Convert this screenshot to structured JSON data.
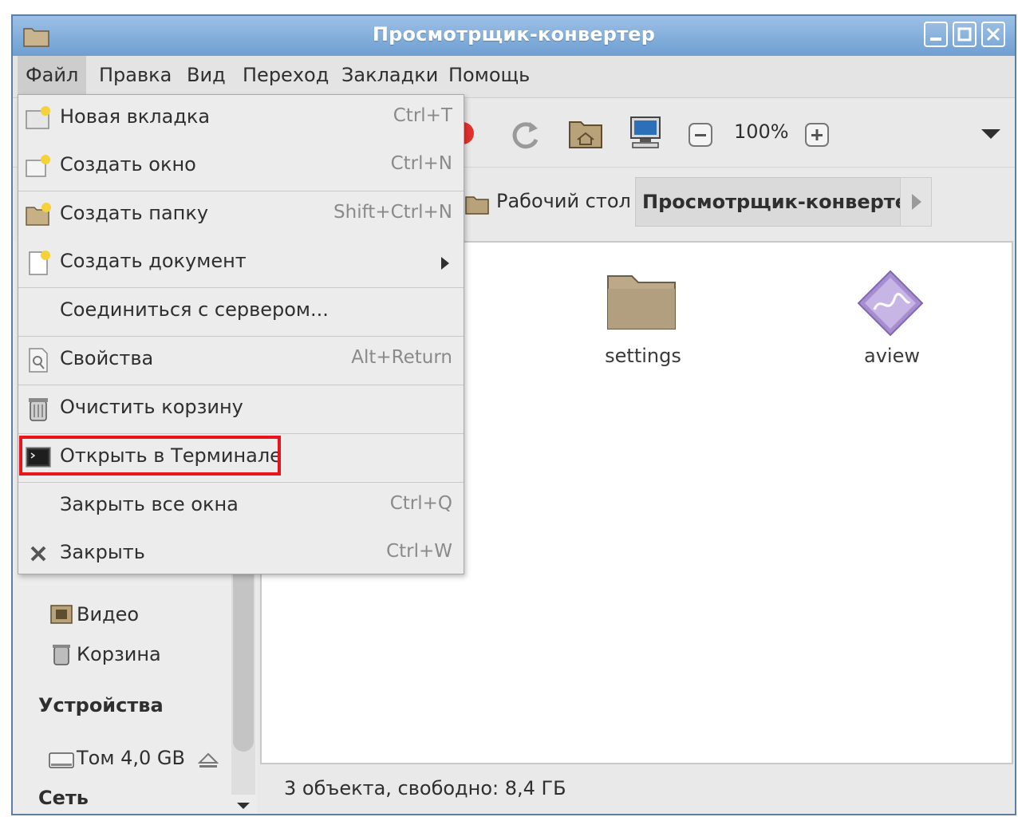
{
  "window": {
    "title": "Просмотрщик-конвертер"
  },
  "menubar": {
    "items": [
      {
        "label": "Файл"
      },
      {
        "label": "Правка"
      },
      {
        "label": "Вид"
      },
      {
        "label": "Переход"
      },
      {
        "label": "Закладки"
      },
      {
        "label": "Помощь"
      }
    ]
  },
  "toolbar": {
    "zoom": "100%"
  },
  "location": {
    "crumbs": [
      {
        "label": "Рабочий стол"
      },
      {
        "label": "Просмотрщик-конвертер"
      }
    ]
  },
  "file_menu": {
    "items": [
      {
        "label": "Новая вкладка",
        "shortcut": "Ctrl+T",
        "icon": "new-tab-icon"
      },
      {
        "label": "Создать окно",
        "shortcut": "Ctrl+N",
        "icon": "new-window-icon"
      },
      {
        "label": "Создать папку",
        "shortcut": "Shift+Ctrl+N",
        "icon": "new-folder-icon"
      },
      {
        "label": "Создать документ",
        "shortcut": "",
        "icon": "new-document-icon"
      },
      {
        "label": "Соединиться с сервером...",
        "shortcut": "",
        "icon": ""
      },
      {
        "label": "Свойства",
        "shortcut": "Alt+Return",
        "icon": "properties-icon"
      },
      {
        "label": "Очистить корзину",
        "shortcut": "",
        "icon": "trash-icon"
      },
      {
        "label": "Открыть в Терминале",
        "shortcut": "",
        "icon": "terminal-icon"
      },
      {
        "label": "Закрыть все окна",
        "shortcut": "Ctrl+Q",
        "icon": ""
      },
      {
        "label": "Закрыть",
        "shortcut": "Ctrl+W",
        "icon": "close-icon"
      }
    ]
  },
  "sidebar": {
    "places": [
      {
        "label": "Видео",
        "icon": "video-folder-icon"
      },
      {
        "label": "Корзина",
        "icon": "trash-icon"
      }
    ],
    "devices_heading": "Устройства",
    "devices": [
      {
        "label": "Том 4,0 GB",
        "icon": "drive-icon"
      }
    ],
    "network_heading": "Сеть"
  },
  "files": [
    {
      "name": "settings",
      "icon": "folder-icon"
    },
    {
      "name": "aview",
      "icon": "app-icon"
    }
  ],
  "status": {
    "text": "3 объекта, свободно: 8,4 ГБ"
  },
  "colors": {
    "highlight": "#e8141c",
    "titlebar": "#7aa7d8"
  }
}
